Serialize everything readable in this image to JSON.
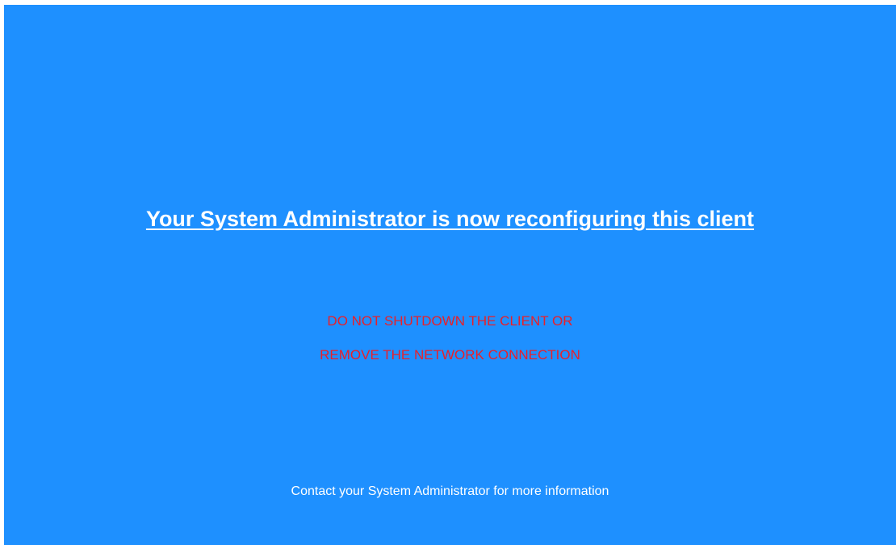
{
  "colors": {
    "background": "#1e90ff",
    "headline": "#ffffff",
    "warning": "#e8202a",
    "footer": "#ffffff"
  },
  "headline": "Your System Administrator is now reconfiguring this client",
  "warning_lines": [
    "DO NOT SHUTDOWN THE CLIENT OR",
    "REMOVE THE NETWORK CONNECTION"
  ],
  "footer": "Contact your System Administrator for more information"
}
